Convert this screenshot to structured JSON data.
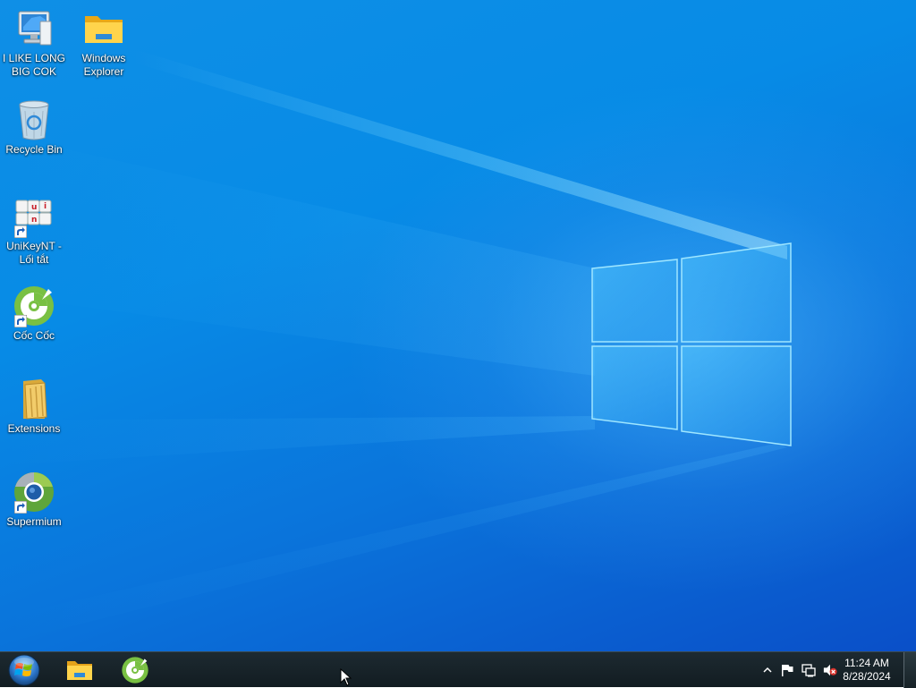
{
  "desktop": {
    "icons": [
      {
        "label": "I LIKE LONG\nBIG COK",
        "icon": "computer-icon"
      },
      {
        "label": "Windows\nExplorer",
        "icon": "folder-icon"
      },
      {
        "label": "Recycle Bin",
        "icon": "recycle-bin-icon"
      },
      {
        "label": "UniKeyNT -\nLối tắt",
        "icon": "unikey-icon"
      },
      {
        "label": "Cốc Cốc",
        "icon": "coccoc-icon"
      },
      {
        "label": "Extensions",
        "icon": "folder-icon"
      },
      {
        "label": "Supermium",
        "icon": "supermium-icon"
      }
    ]
  },
  "taskbar": {
    "start": {
      "icon": "windows-start-icon"
    },
    "pinned": [
      {
        "name": "Windows Explorer",
        "icon": "file-explorer-icon"
      },
      {
        "name": "Cốc Cốc",
        "icon": "coccoc-icon"
      }
    ],
    "tray": {
      "icons": [
        "show-hidden-icons-icon",
        "action-center-flag-icon",
        "network-icon",
        "volume-muted-icon"
      ],
      "time": "11:24 AM",
      "date": "8/28/2024"
    }
  },
  "colors": {
    "desktop_top": "#0f8fe6",
    "desktop_bottom": "#0a4fc8",
    "taskbar": "#162126",
    "logo_glow": "#7fd8ff"
  }
}
